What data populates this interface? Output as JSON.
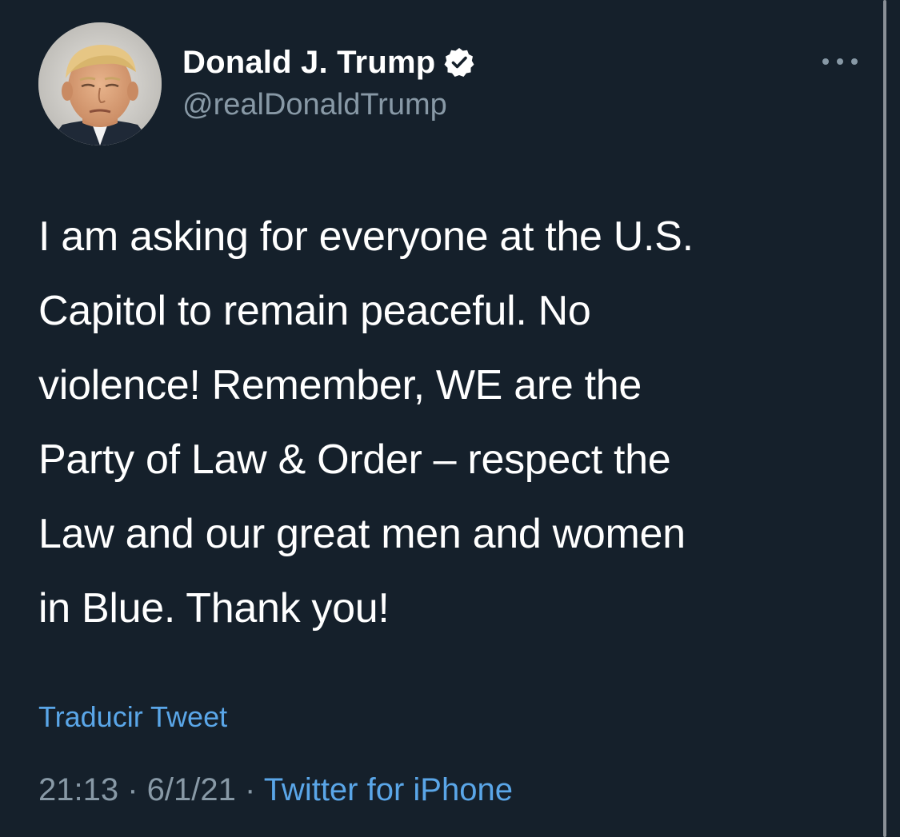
{
  "user": {
    "display_name": "Donald J. Trump",
    "handle": "@realDonaldTrump",
    "verified": true,
    "avatar_icon": "profile-photo"
  },
  "tweet": {
    "lines": [
      "I am asking for everyone at the U.S.",
      "Capitol to remain peaceful. No",
      "violence! Remember, WE are the",
      "Party of Law & Order – respect the",
      "Law and our great men and women",
      "in Blue. Thank you!"
    ],
    "translate_label": "Traducir Tweet",
    "time": "21:13",
    "separator": " · ",
    "date": "6/1/21",
    "source": "Twitter for iPhone"
  },
  "icons": {
    "more": "more-horizontal-icon",
    "verified": "verified-badge-icon"
  },
  "colors": {
    "background": "#15202b",
    "text": "#ffffff",
    "secondary": "#8899a6",
    "link": "#5aa6e8"
  }
}
